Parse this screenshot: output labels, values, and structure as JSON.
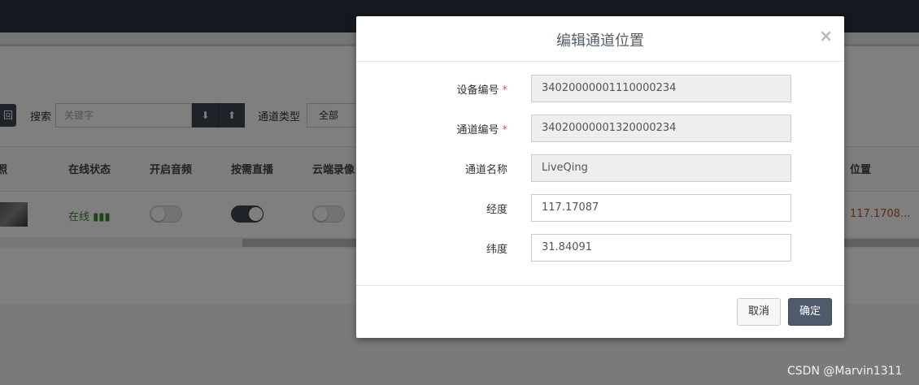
{
  "background": {
    "back_label": "回",
    "search_label": "搜索",
    "search_placeholder": "关键字",
    "download_icon": "⬇",
    "upload_icon": "⬆",
    "channel_type_label": "通道类型",
    "channel_type_value": "全部",
    "columns": [
      "照",
      "在线状态",
      "开启音频",
      "按需直播",
      "云端录像",
      "位置"
    ],
    "row": {
      "online_status": "在线",
      "audio_enabled": false,
      "on_demand": true,
      "cloud_record": false,
      "position": "117.1708..."
    }
  },
  "modal": {
    "title": "编辑通道位置",
    "close": "×",
    "fields": [
      {
        "label": "设备编号",
        "value": "34020000001110000234",
        "required": true,
        "readonly": true
      },
      {
        "label": "通道编号",
        "value": "34020000001320000234",
        "required": true,
        "readonly": true
      },
      {
        "label": "通道名称",
        "value": "LiveQing",
        "required": false,
        "readonly": true
      },
      {
        "label": "经度",
        "value": "117.17087",
        "required": false,
        "readonly": false
      },
      {
        "label": "纬度",
        "value": "31.84091",
        "required": false,
        "readonly": false
      }
    ],
    "required_mark": "*",
    "cancel_label": "取消",
    "ok_label": "确定"
  },
  "watermark": "CSDN @Marvin1311"
}
